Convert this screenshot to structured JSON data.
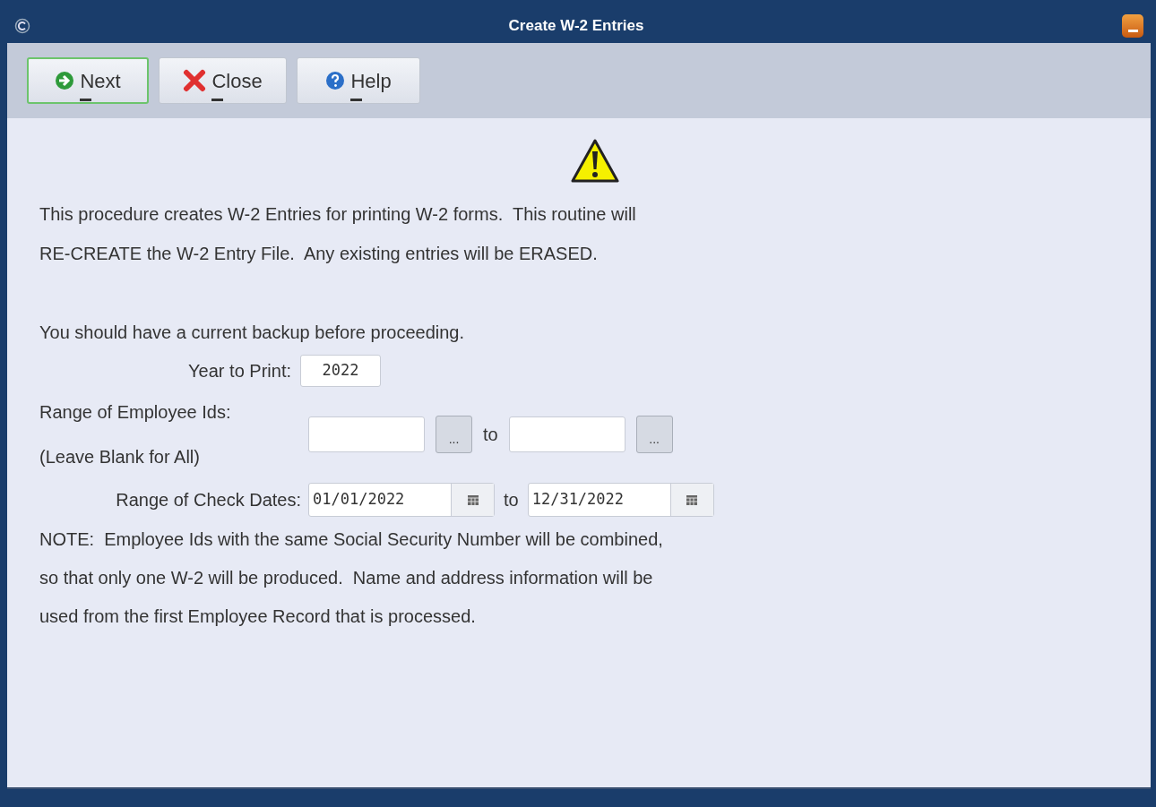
{
  "window": {
    "title": "Create W-2 Entries"
  },
  "toolbar": [
    {
      "kind": "next",
      "label": "Next",
      "default": true
    },
    {
      "kind": "close",
      "label": "Close",
      "default": false
    },
    {
      "kind": "help",
      "label": "Help",
      "default": false
    }
  ],
  "intro": [
    "This procedure creates W-2 Entries for printing W-2 forms.  This routine will",
    "RE-CREATE the W-2 Entry File.  Any existing entries will be ERASED."
  ],
  "backup_note": "You should have a current backup before proceeding.",
  "year": {
    "label": "Year to Print:",
    "value": "2022"
  },
  "employee_range": {
    "label": "Range of Employee Ids:",
    "hint": "(Leave Blank for All)",
    "lookup_button": "...",
    "to": "to"
  },
  "date_range": {
    "label": "Range of Check Dates:",
    "from": "01/01/2022",
    "to_label": "to",
    "to": "12/31/2022"
  },
  "note": [
    "NOTE:  Employee Ids with the same Social Security Number will be combined,",
    "so that only one W-2 will be produced.  Name and address information will be",
    "used from the first Employee Record that is processed."
  ]
}
